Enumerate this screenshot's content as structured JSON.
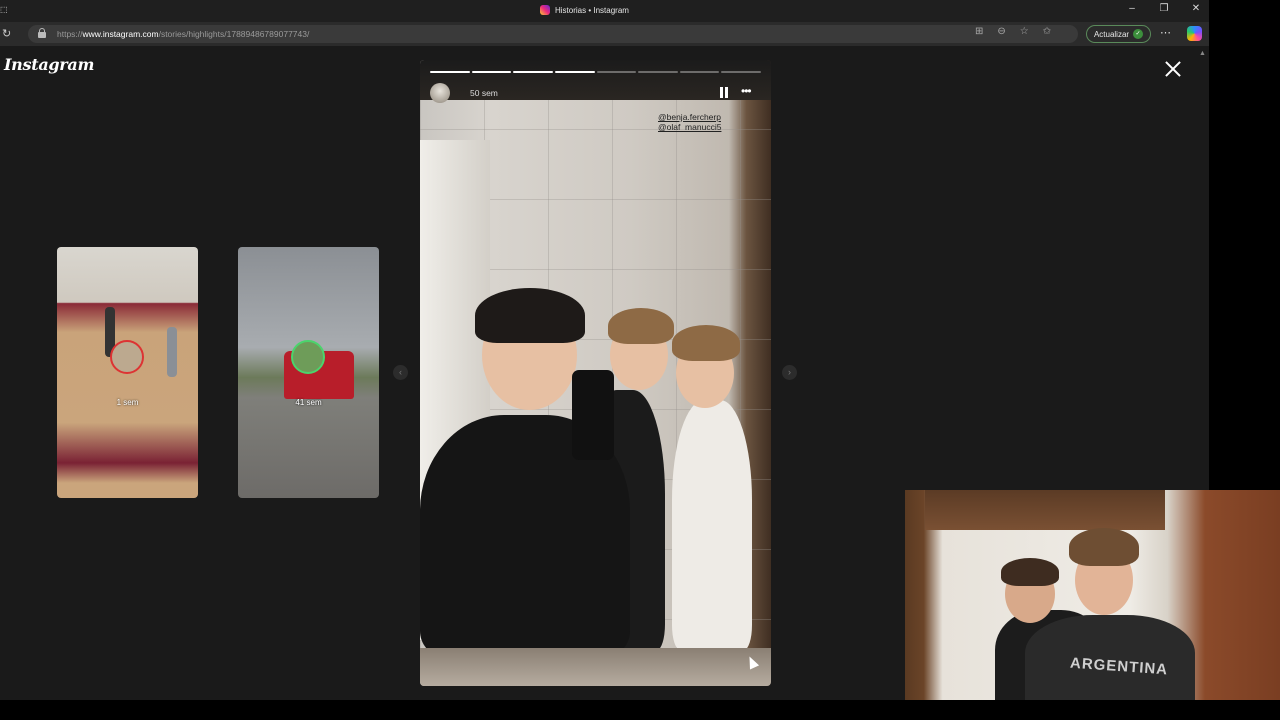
{
  "browser": {
    "tab_title": "Historias • Instagram",
    "url_prefix": "https://",
    "url_host": "www.instagram.com",
    "url_path": "/stories/highlights/17889486789077743/",
    "update_button": "Actualizar"
  },
  "page": {
    "logo": "Instagram",
    "thumbnails": [
      {
        "timestamp": "1 sem"
      },
      {
        "timestamp": "41 sem"
      }
    ],
    "story": {
      "time_ago": "50 sem",
      "progress_segments_total": 8,
      "progress_segments_done": 4,
      "mentions": [
        "@benja.fercherp",
        "@olaf_manucci5"
      ]
    }
  },
  "webcam": {
    "shirt_text": "ARGENTINA"
  },
  "icons": {
    "close": "close-icon",
    "pause": "pause-icon",
    "more": "more-icon",
    "prev": "chevron-left-icon",
    "next": "chevron-right-icon"
  }
}
